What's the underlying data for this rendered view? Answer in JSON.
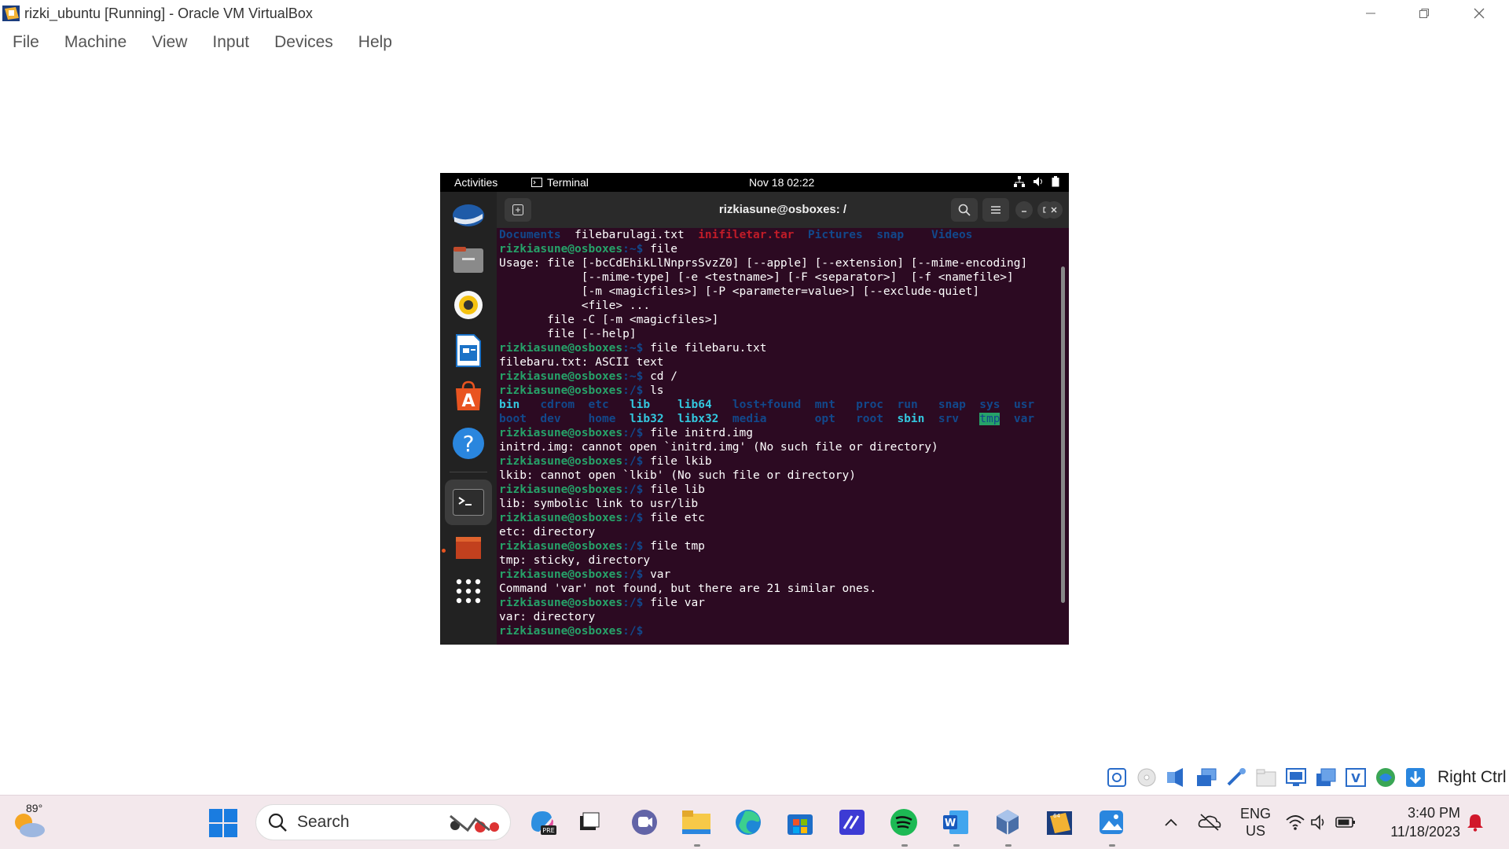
{
  "window": {
    "title": "rizki_ubuntu [Running] - Oracle VM VirtualBox",
    "icon": "virtualbox-icon"
  },
  "menubar": [
    "File",
    "Machine",
    "View",
    "Input",
    "Devices",
    "Help"
  ],
  "gnome": {
    "activities": "Activities",
    "app": "Terminal",
    "clock": "Nov 18  02:22"
  },
  "terminal": {
    "title": "rizkiasune@osboxes: /",
    "prompt_user": "rizkiasune@osboxes",
    "lines": [
      {
        "segs": [
          [
            "Documents",
            "dirc"
          ],
          [
            "  filebarulagi.txt  ",
            ""
          ],
          [
            "inifiletar.tar",
            "red"
          ],
          [
            "  ",
            ""
          ],
          [
            "Pictures",
            "dirc"
          ],
          [
            "  ",
            ""
          ],
          [
            "snap",
            "dirc"
          ],
          [
            "    ",
            ""
          ],
          [
            "Videos",
            "dirc"
          ]
        ]
      },
      {
        "segs": [
          [
            "rizkiasune@osboxes",
            "prompt"
          ],
          [
            ":~$ file",
            ""
          ]
        ]
      },
      {
        "segs": [
          [
            "Usage: file [-bcCdEhikLlNnprsSvzZ0] [--apple] [--extension] [--mime-encoding]",
            ""
          ]
        ]
      },
      {
        "segs": [
          [
            "            [--mime-type] [-e <testname>] [-F <separator>]  [-f <namefile>]",
            ""
          ]
        ]
      },
      {
        "segs": [
          [
            "            [-m <magicfiles>] [-P <parameter=value>] [--exclude-quiet]",
            ""
          ]
        ]
      },
      {
        "segs": [
          [
            "            <file> ...",
            ""
          ]
        ]
      },
      {
        "segs": [
          [
            "       file -C [-m <magicfiles>]",
            ""
          ]
        ]
      },
      {
        "segs": [
          [
            "       file [--help]",
            ""
          ]
        ]
      },
      {
        "segs": [
          [
            "rizkiasune@osboxes",
            "prompt"
          ],
          [
            ":~$ file filebaru.txt",
            ""
          ]
        ]
      },
      {
        "segs": [
          [
            "filebaru.txt: ASCII text",
            ""
          ]
        ]
      },
      {
        "segs": [
          [
            "rizkiasune@osboxes",
            "prompt"
          ],
          [
            ":~$ cd /",
            ""
          ]
        ]
      },
      {
        "segs": [
          [
            "rizkiasune@osboxes",
            "prompt"
          ],
          [
            ":/$ ls",
            ""
          ]
        ]
      },
      {
        "segs": [
          [
            "bin",
            "cyan"
          ],
          [
            "   ",
            ""
          ],
          [
            "cdrom",
            "dirc"
          ],
          [
            "  ",
            ""
          ],
          [
            "etc",
            "dirc"
          ],
          [
            "   ",
            ""
          ],
          [
            "lib",
            "cyan"
          ],
          [
            "    ",
            ""
          ],
          [
            "lib64",
            "cyan"
          ],
          [
            "   ",
            ""
          ],
          [
            "lost+found",
            "dirc"
          ],
          [
            "  ",
            ""
          ],
          [
            "mnt",
            "dirc"
          ],
          [
            "   ",
            ""
          ],
          [
            "proc",
            "dirc"
          ],
          [
            "  ",
            ""
          ],
          [
            "run",
            "dirc"
          ],
          [
            "   ",
            ""
          ],
          [
            "snap",
            "dirc"
          ],
          [
            "  ",
            ""
          ],
          [
            "sys",
            "dirc"
          ],
          [
            "  ",
            ""
          ],
          [
            "usr",
            "dirc"
          ]
        ]
      },
      {
        "segs": [
          [
            "boot",
            "dirc"
          ],
          [
            "  ",
            ""
          ],
          [
            "dev",
            "dirc"
          ],
          [
            "    ",
            ""
          ],
          [
            "home",
            "dirc"
          ],
          [
            "  ",
            ""
          ],
          [
            "lib32",
            "cyan"
          ],
          [
            "  ",
            ""
          ],
          [
            "libx32",
            "cyan"
          ],
          [
            "  ",
            ""
          ],
          [
            "media",
            "dirc"
          ],
          [
            "       ",
            ""
          ],
          [
            "opt",
            "dirc"
          ],
          [
            "   ",
            ""
          ],
          [
            "root",
            "dirc"
          ],
          [
            "  ",
            ""
          ],
          [
            "sbin",
            "cyan"
          ],
          [
            "  ",
            ""
          ],
          [
            "srv",
            "dirc"
          ],
          [
            "   ",
            ""
          ],
          [
            "tmp",
            "tmp"
          ],
          [
            "  ",
            ""
          ],
          [
            "var",
            "dirc"
          ]
        ]
      },
      {
        "segs": [
          [
            "rizkiasune@osboxes",
            "prompt"
          ],
          [
            ":/$ file initrd.img",
            ""
          ]
        ]
      },
      {
        "segs": [
          [
            "initrd.img: cannot open `initrd.img' (No such file or directory)",
            ""
          ]
        ]
      },
      {
        "segs": [
          [
            "rizkiasune@osboxes",
            "prompt"
          ],
          [
            ":/$ file lkib",
            ""
          ]
        ]
      },
      {
        "segs": [
          [
            "lkib: cannot open `lkib' (No such file or directory)",
            ""
          ]
        ]
      },
      {
        "segs": [
          [
            "rizkiasune@osboxes",
            "prompt"
          ],
          [
            ":/$ file lib",
            ""
          ]
        ]
      },
      {
        "segs": [
          [
            "lib: symbolic link to usr/lib",
            ""
          ]
        ]
      },
      {
        "segs": [
          [
            "rizkiasune@osboxes",
            "prompt"
          ],
          [
            ":/$ file etc",
            ""
          ]
        ]
      },
      {
        "segs": [
          [
            "etc: directory",
            ""
          ]
        ]
      },
      {
        "segs": [
          [
            "rizkiasune@osboxes",
            "prompt"
          ],
          [
            ":/$ file tmp",
            ""
          ]
        ]
      },
      {
        "segs": [
          [
            "tmp: sticky, directory",
            ""
          ]
        ]
      },
      {
        "segs": [
          [
            "rizkiasune@osboxes",
            "prompt"
          ],
          [
            ":/$ var",
            ""
          ]
        ]
      },
      {
        "segs": [
          [
            "Command 'var' not found, but there are 21 similar ones.",
            ""
          ]
        ]
      },
      {
        "segs": [
          [
            "rizkiasune@osboxes",
            "prompt"
          ],
          [
            ":/$ file var",
            ""
          ]
        ]
      },
      {
        "segs": [
          [
            "var: directory",
            ""
          ]
        ]
      },
      {
        "segs": [
          [
            "rizkiasune@osboxes",
            "prompt"
          ],
          [
            ":/$",
            ""
          ]
        ]
      }
    ]
  },
  "statusbar": {
    "host_key": "Right Ctrl"
  },
  "taskbar": {
    "temperature": "89°",
    "search_label": "Search",
    "lang_line1": "ENG",
    "lang_line2": "US",
    "time": "3:40 PM",
    "date": "11/18/2023"
  },
  "colors": {
    "terminal_bg": "#2c0a22",
    "prompt_green": "#26a269",
    "path_blue": "#12488b",
    "dir_cyan": "#33c7de",
    "archive_red": "#c01c28"
  }
}
